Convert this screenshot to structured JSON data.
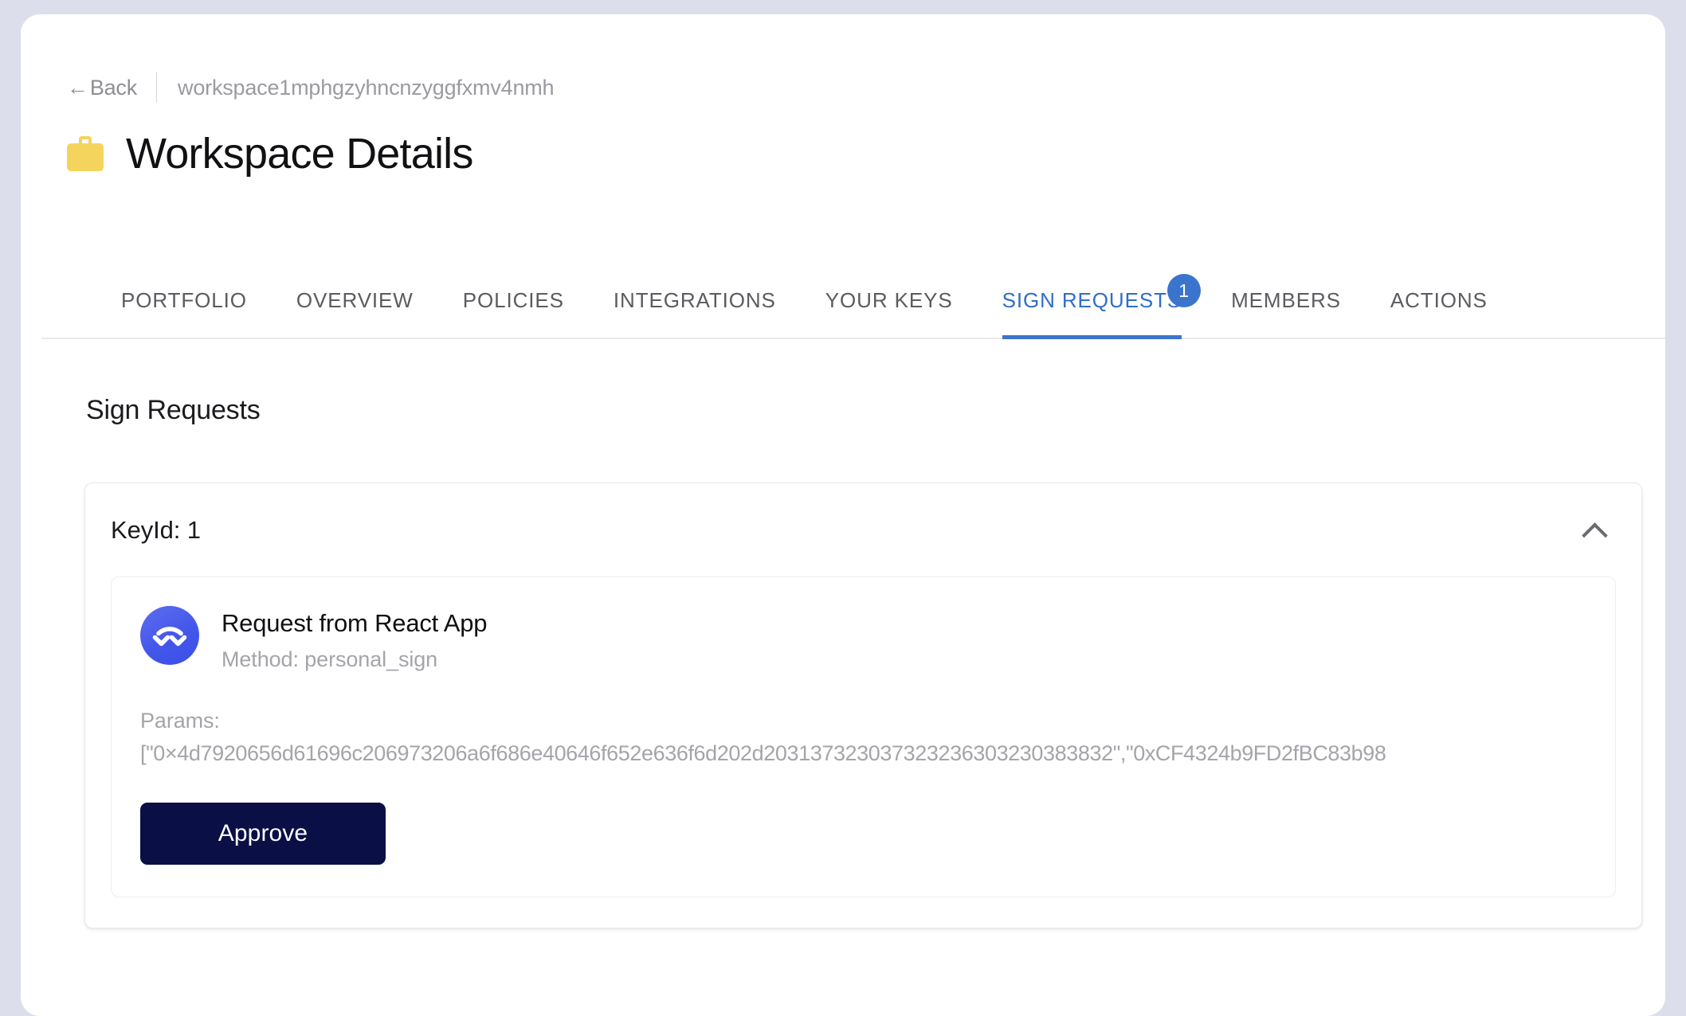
{
  "colors": {
    "page_background": "#dcdfeb",
    "card_background": "#ffffff",
    "accent_blue": "#3b74cc",
    "active_tab_text": "#2f6dc9",
    "briefcase_yellow": "#f5d45e",
    "approve_button": "#0a1046",
    "muted_text": "#a4a4aa",
    "walletconnect_blue": "#4457ea"
  },
  "breadcrumb": {
    "back_label": "Back",
    "back_arrow": "←",
    "workspace_id": "workspace1mphgzyhncnzyggfxmv4nmh"
  },
  "header": {
    "icon": "briefcase-icon",
    "title": "Workspace Details"
  },
  "tabs": [
    {
      "label": "PORTFOLIO",
      "active": false
    },
    {
      "label": "OVERVIEW",
      "active": false
    },
    {
      "label": "POLICIES",
      "active": false
    },
    {
      "label": "INTEGRATIONS",
      "active": false
    },
    {
      "label": "YOUR KEYS",
      "active": false
    },
    {
      "label": "SIGN REQUESTS",
      "active": true,
      "badge": "1"
    },
    {
      "label": "MEMBERS",
      "active": false
    },
    {
      "label": "ACTIONS",
      "active": false
    }
  ],
  "main": {
    "section_title": "Sign Requests",
    "group": {
      "label": "KeyId: 1",
      "collapse_icon": "chevron-up-icon",
      "expanded": true
    },
    "request": {
      "avatar_icon": "walletconnect-icon",
      "title": "Request from React App",
      "method": "Method: personal_sign",
      "params_label": "Params:",
      "params_value": "[\"0×4d7920656d61696c206973206a6f686e40646f652e636f6d202d203137323037323236303230383832\",\"0xCF4324b9FD2fBC83b98",
      "approve_label": "Approve"
    }
  }
}
